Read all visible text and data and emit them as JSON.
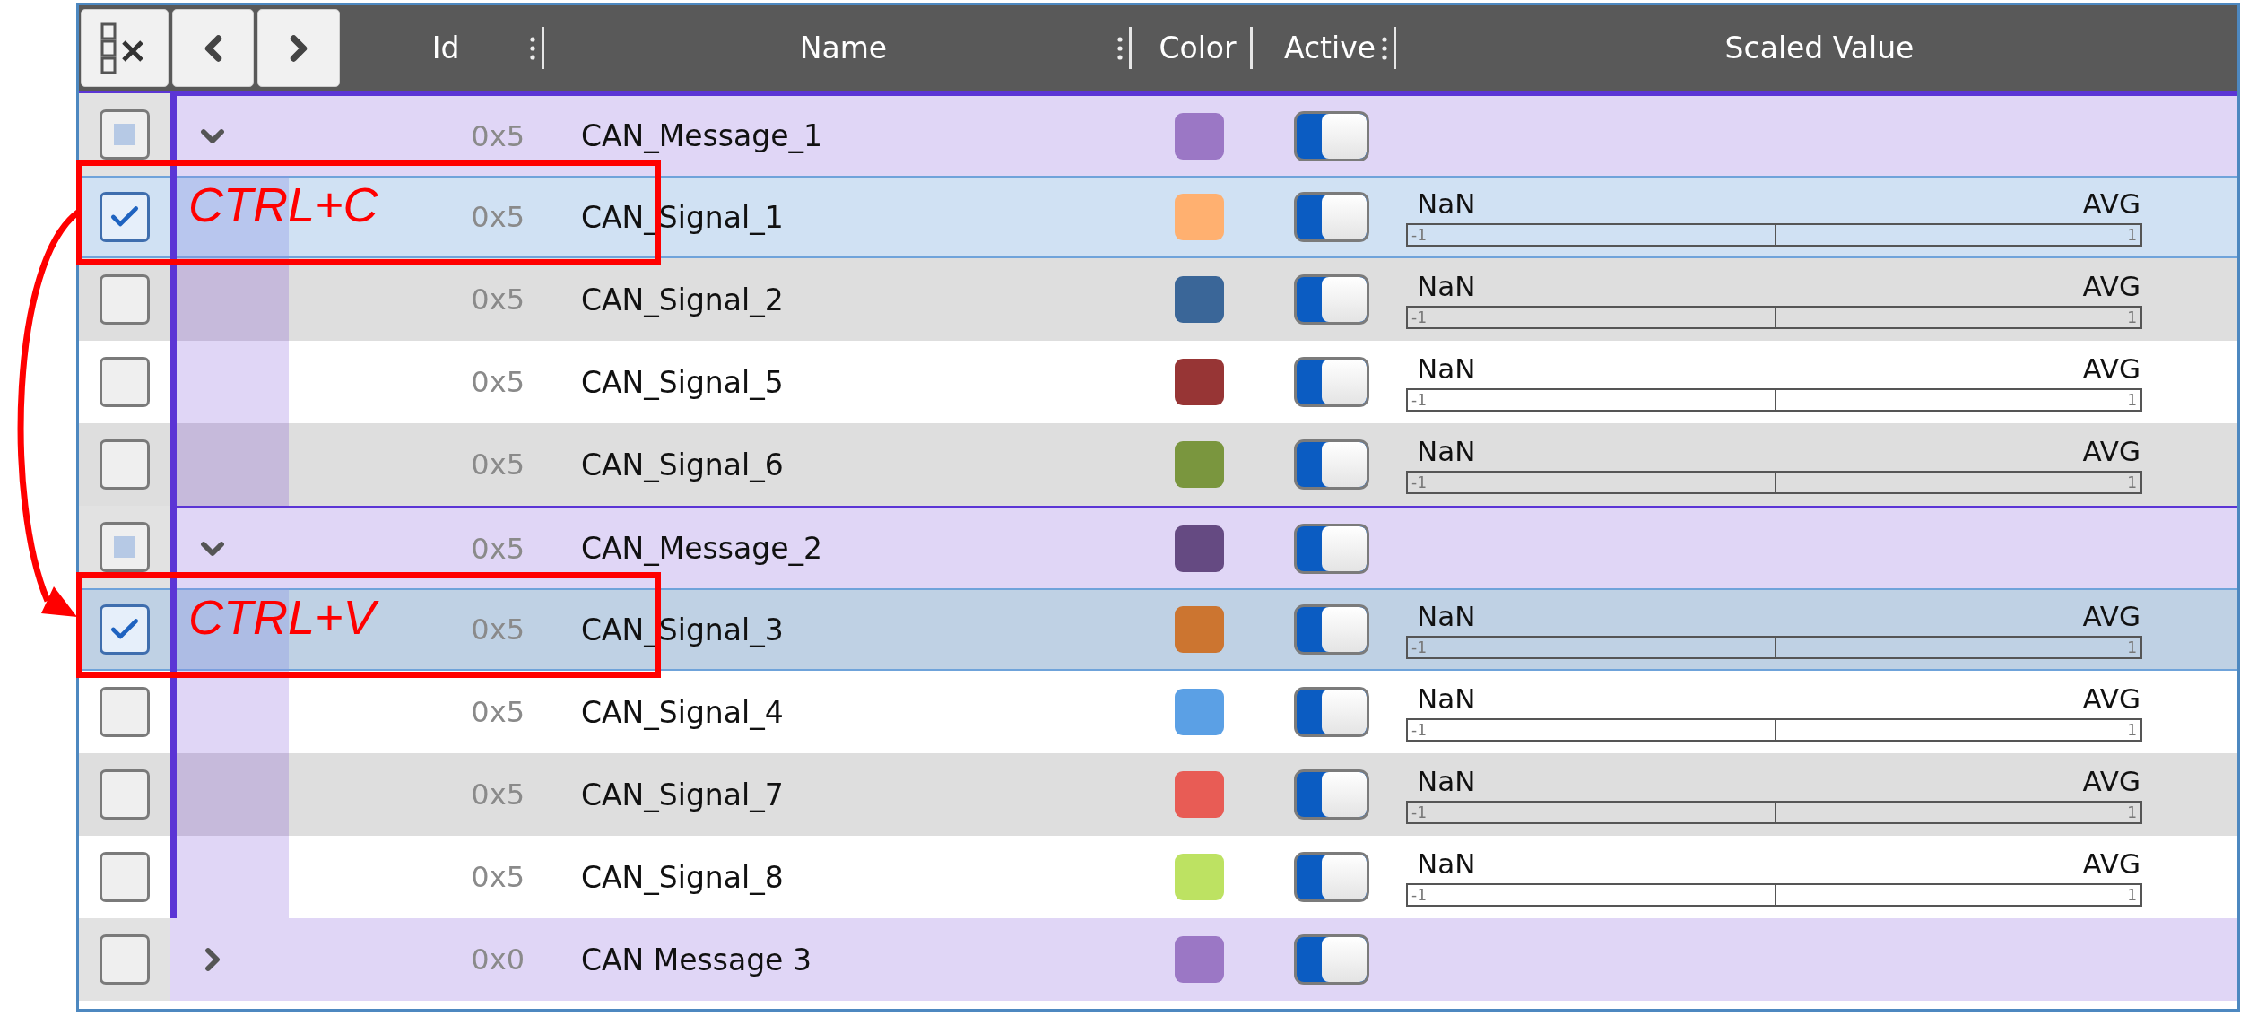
{
  "header": {
    "columns": [
      {
        "label": "Id",
        "grip": true,
        "separator": true
      },
      {
        "label": "Name",
        "grip": true,
        "separator": true
      },
      {
        "label": "Color",
        "grip": false,
        "separator": true
      },
      {
        "label": "Active",
        "grip": true,
        "separator": true
      },
      {
        "label": "Scaled Value",
        "grip": false,
        "separator": false
      }
    ]
  },
  "messages": [
    {
      "id": "0x5",
      "name": "CAN_Message_1",
      "color": "#9b77c5",
      "active": true,
      "checked": false,
      "partial": true,
      "expanded": true,
      "children": [
        {
          "id": "0x5",
          "name": "CAN_Signal_1",
          "color": "#ffb070",
          "active": true,
          "checked": true,
          "selected": true,
          "annotation": "CTRL+C",
          "reading": "NaN",
          "mode": "AVG",
          "min": "-1",
          "max": "1"
        },
        {
          "id": "0x5",
          "name": "CAN_Signal_2",
          "color": "#3a6698",
          "active": true,
          "checked": false,
          "selected": false,
          "reading": "NaN",
          "mode": "AVG",
          "min": "-1",
          "max": "1"
        },
        {
          "id": "0x5",
          "name": "CAN_Signal_5",
          "color": "#973535",
          "active": true,
          "checked": false,
          "selected": false,
          "reading": "NaN",
          "mode": "AVG",
          "min": "-1",
          "max": "1"
        },
        {
          "id": "0x5",
          "name": "CAN_Signal_6",
          "color": "#7a963e",
          "active": true,
          "checked": false,
          "selected": false,
          "reading": "NaN",
          "mode": "AVG",
          "min": "-1",
          "max": "1"
        }
      ]
    },
    {
      "id": "0x5",
      "name": "CAN_Message_2",
      "color": "#654a82",
      "active": true,
      "checked": false,
      "partial": true,
      "expanded": true,
      "children": [
        {
          "id": "0x5",
          "name": "CAN_Signal_3",
          "color": "#cc7530",
          "active": true,
          "checked": true,
          "selected": true,
          "annotation": "CTRL+V",
          "reading": "NaN",
          "mode": "AVG",
          "min": "-1",
          "max": "1"
        },
        {
          "id": "0x5",
          "name": "CAN_Signal_4",
          "color": "#5ba0e5",
          "active": true,
          "checked": false,
          "selected": false,
          "reading": "NaN",
          "mode": "AVG",
          "min": "-1",
          "max": "1"
        },
        {
          "id": "0x5",
          "name": "CAN_Signal_7",
          "color": "#e85c55",
          "active": true,
          "checked": false,
          "selected": false,
          "reading": "NaN",
          "mode": "AVG",
          "min": "-1",
          "max": "1"
        },
        {
          "id": "0x5",
          "name": "CAN_Signal_8",
          "color": "#bde262",
          "active": true,
          "checked": false,
          "selected": false,
          "reading": "NaN",
          "mode": "AVG",
          "min": "-1",
          "max": "1"
        }
      ]
    },
    {
      "id": "0x0",
      "name": "CAN Message 3",
      "color": "#9b77c5",
      "active": true,
      "checked": false,
      "partial": false,
      "expanded": false
    }
  ]
}
